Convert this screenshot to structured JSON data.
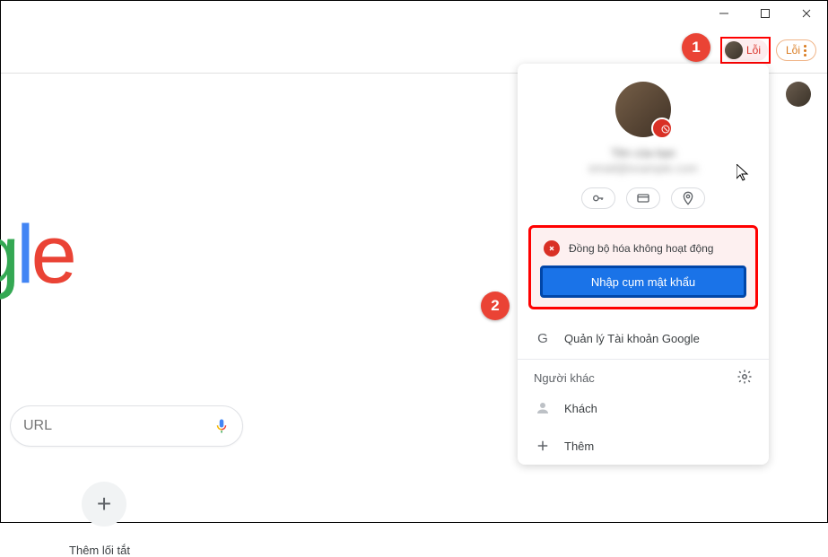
{
  "window": {
    "minimize": "minimize",
    "maximize": "maximize",
    "close": "close"
  },
  "toolbar": {
    "profile_error_label": "Lỗi",
    "menu_error_label": "Lỗi"
  },
  "search": {
    "placeholder": "URL"
  },
  "shortcut": {
    "add_label": "Thêm lối tắt"
  },
  "popover": {
    "user_name": "Tên của bạn",
    "user_email": "email@example.com",
    "sync_off_label": "Đồng bộ hóa không hoạt động",
    "passphrase_btn": "Nhập cụm mật khẩu",
    "manage_account": "Quản lý Tài khoản Google",
    "other_people": "Người khác",
    "guest": "Khách",
    "add": "Thêm"
  },
  "callouts": {
    "one": "1",
    "two": "2"
  }
}
